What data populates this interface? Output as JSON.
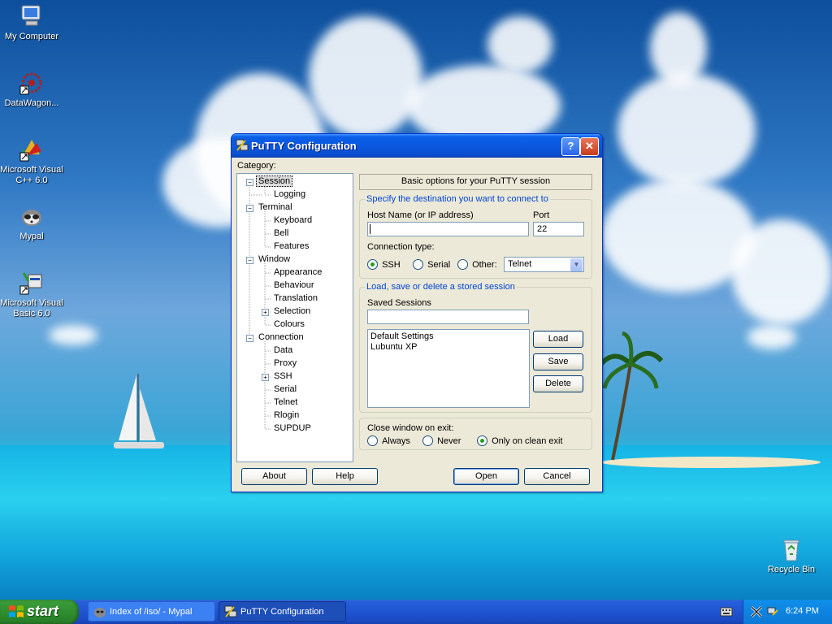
{
  "desktop": {
    "icons": [
      {
        "label": "My Computer",
        "icon": "my-computer-icon"
      },
      {
        "label": "DataWagon...",
        "icon": "datawagon-icon"
      },
      {
        "label": "Microsoft Visual C++ 6.0",
        "icon": "visual-cpp-icon"
      },
      {
        "label": "Mypal",
        "icon": "mypal-icon"
      },
      {
        "label": "Microsoft Visual Basic 6.0",
        "icon": "visual-basic-icon"
      },
      {
        "label": "Recycle Bin",
        "icon": "recycle-bin-icon"
      }
    ]
  },
  "window": {
    "title": "PuTTY Configuration",
    "help_glyph": "?",
    "close_glyph": "✕",
    "category_label": "Category:",
    "tree": {
      "session": "Session",
      "logging": "Logging",
      "terminal": "Terminal",
      "keyboard": "Keyboard",
      "bell": "Bell",
      "features": "Features",
      "window": "Window",
      "appearance": "Appearance",
      "behaviour": "Behaviour",
      "translation": "Translation",
      "selection": "Selection",
      "colours": "Colours",
      "connection": "Connection",
      "data": "Data",
      "proxy": "Proxy",
      "ssh": "SSH",
      "serial": "Serial",
      "telnet": "Telnet",
      "rlogin": "Rlogin",
      "supdup": "SUPDUP"
    },
    "panel_header": "Basic options for your PuTTY session",
    "destination_group": "Specify the destination you want to connect to",
    "host_label": "Host Name (or IP address)",
    "host_value": "",
    "port_label": "Port",
    "port_value": "22",
    "conn_type_label": "Connection type:",
    "conn_types": {
      "ssh": "SSH",
      "serial": "Serial",
      "other": "Other:"
    },
    "conn_type_selected": "SSH",
    "other_protocol": "Telnet",
    "sessions_group": "Load, save or delete a stored session",
    "saved_sessions_label": "Saved Sessions",
    "saved_sessions_value": "",
    "sessions": [
      "Default Settings",
      "Lubuntu XP"
    ],
    "load": "Load",
    "save": "Save",
    "delete": "Delete",
    "close_exit_label": "Close window on exit:",
    "close_exit": {
      "always": "Always",
      "never": "Never",
      "clean": "Only on clean exit"
    },
    "close_exit_selected": "Only on clean exit",
    "about": "About",
    "help": "Help",
    "open": "Open",
    "cancel": "Cancel"
  },
  "taskbar": {
    "start": "start",
    "tasks": [
      {
        "label": "Index of /iso/ - Mypal",
        "active": false
      },
      {
        "label": "PuTTY Configuration",
        "active": true
      }
    ],
    "clock": "6:24 PM"
  }
}
